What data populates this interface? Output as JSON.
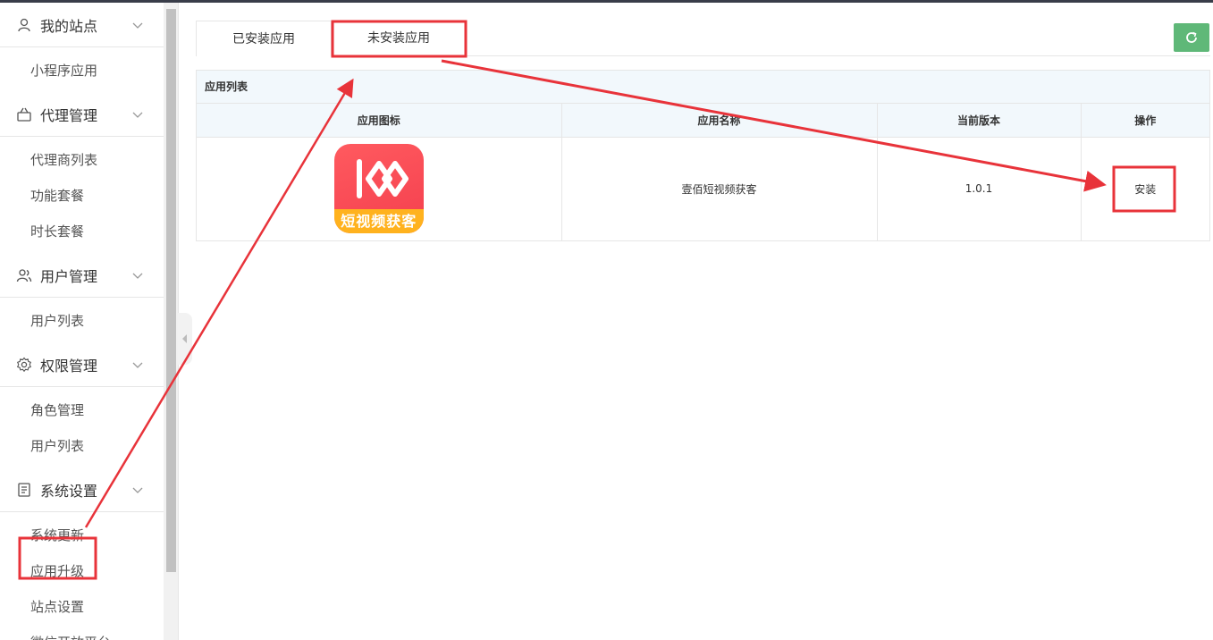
{
  "sidebar": {
    "groups": [
      {
        "label": "我的站点",
        "icon": "user-icon",
        "items": [
          "小程序应用"
        ]
      },
      {
        "label": "代理管理",
        "icon": "basket-icon",
        "items": [
          "代理商列表",
          "功能套餐",
          "时长套餐"
        ]
      },
      {
        "label": "用户管理",
        "icon": "users-icon",
        "items": [
          "用户列表"
        ]
      },
      {
        "label": "权限管理",
        "icon": "gear-icon",
        "items": [
          "角色管理",
          "用户列表"
        ]
      },
      {
        "label": "系统设置",
        "icon": "document-icon",
        "items": [
          "系统更新",
          "应用升级",
          "站点设置",
          "微信开放平台"
        ]
      }
    ]
  },
  "tabs": {
    "installed": "已安装应用",
    "uninstalled": "未安装应用",
    "active": "uninstalled"
  },
  "refresh": {
    "icon": "refresh-icon"
  },
  "table": {
    "caption": "应用列表",
    "headers": [
      "应用图标",
      "应用名称",
      "当前版本",
      "操作"
    ],
    "rows": [
      {
        "icon_text": "短视频获客",
        "name": "壹佰短视频获客",
        "version": "1.0.1",
        "action": "安装"
      }
    ]
  },
  "colors": {
    "accent_green": "#5fb878",
    "annotation_red": "#e8333a",
    "icon_red": "#f43f4e",
    "icon_band": "#ffb21e"
  }
}
